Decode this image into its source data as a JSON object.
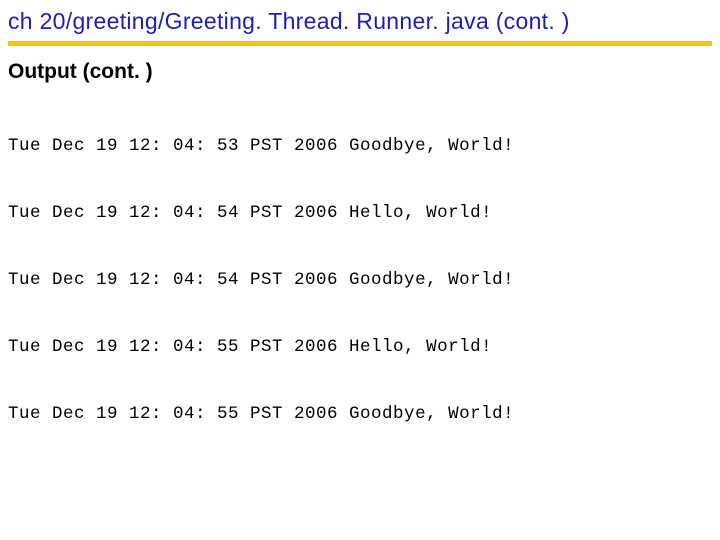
{
  "title": "ch 20/greeting/Greeting. Thread. Runner. java  (cont. )",
  "section_heading": "Output (cont. )",
  "output_lines": [
    "Tue Dec 19 12: 04: 53 PST 2006 Goodbye, World!",
    "Tue Dec 19 12: 04: 54 PST 2006 Hello, World!",
    "Tue Dec 19 12: 04: 54 PST 2006 Goodbye, World!",
    "Tue Dec 19 12: 04: 55 PST 2006 Hello, World!",
    "Tue Dec 19 12: 04: 55 PST 2006 Goodbye, World!"
  ]
}
